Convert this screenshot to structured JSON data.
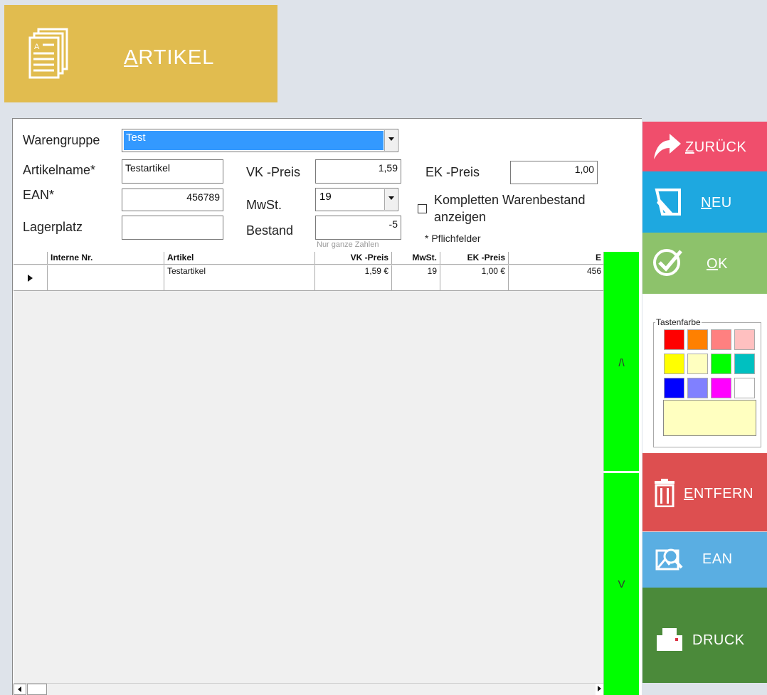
{
  "header": {
    "title_first": "A",
    "title_rest": "RTIKEL",
    "bg": "#e1bc4f"
  },
  "form": {
    "warengruppe_label": "Warengruppe",
    "warengruppe_value": "Test",
    "artikelname_label": "Artikelname*",
    "artikelname_value": "Testartikel",
    "ean_label": "EAN*",
    "ean_value": "456789",
    "lagerplatz_label": "Lagerplatz",
    "lagerplatz_value": "",
    "vk_label": "VK -Preis",
    "vk_value": "1,59",
    "mwst_label": "MwSt.",
    "mwst_value": "19",
    "bestand_label": "Bestand",
    "bestand_value": "-5",
    "bestand_hint": "Nur ganze Zahlen",
    "ek_label": "EK -Preis",
    "ek_value": "1,00",
    "checkbox_label_1": "Kompletten Warenbestand",
    "checkbox_label_2": "anzeigen",
    "checkbox_checked": false,
    "pflicht_note": "* Pflichfelder"
  },
  "grid": {
    "columns": [
      "Interne Nr.",
      "Artikel",
      "VK -Preis",
      "MwSt.",
      "EK -Preis",
      "E"
    ],
    "rows": [
      {
        "interne_nr": "",
        "artikel": "Testartikel",
        "vk": "1,59 €",
        "mwst": "19",
        "ek": "1,00 €",
        "ean": "456"
      }
    ]
  },
  "scroll": {
    "up_label": "/\\",
    "down_label": "V"
  },
  "buttons": {
    "zurueck": {
      "key": "Z",
      "rest": "URÜCK",
      "color": "#f04e6c"
    },
    "neu": {
      "key": "N",
      "rest": "EU",
      "color": "#1ea8e0"
    },
    "ok": {
      "key": "O",
      "rest": "K",
      "color": "#8dc26b"
    },
    "entfernen": {
      "key": "E",
      "rest": "NTFERN",
      "color": "#dd4f50"
    },
    "ean": {
      "label": "EAN",
      "color": "#5aaee2"
    },
    "druck": {
      "label": "DRUCK",
      "color": "#4b8a3a"
    }
  },
  "palette": {
    "legend": "Tastenfarbe",
    "colors": [
      "#ff0000",
      "#ff8000",
      "#ff8080",
      "#ffc0c0",
      "#ffff00",
      "#ffffc0",
      "#00ff00",
      "#00c0c0",
      "#0000ff",
      "#8080ff",
      "#ff00ff",
      "#ffffff"
    ],
    "selected": "#ffffc0"
  }
}
